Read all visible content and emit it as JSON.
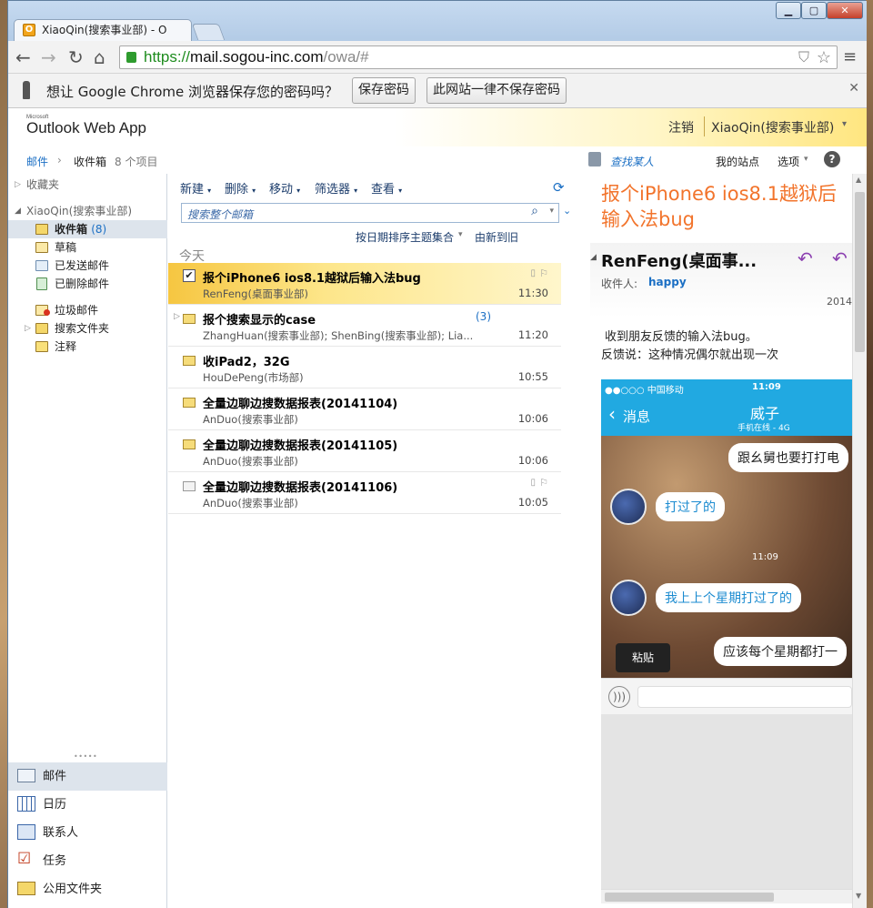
{
  "browser": {
    "tab_title": "XiaoQin(搜索事业部) - O",
    "url_https": "https://",
    "url_host": "mail.sogou-inc.com",
    "url_path": "/owa/#",
    "window_controls": [
      "minimize-icon",
      "maximize-icon",
      "close-icon"
    ]
  },
  "infobar": {
    "message": "想让 Google Chrome 浏览器保存您的密码吗？",
    "save_label": "保存密码",
    "never_label": "此网站一律不保存密码"
  },
  "owa": {
    "logo_small": "Microsoft",
    "logo": "Outlook Web App",
    "signout": "注销",
    "user": "XiaoQin(搜索事业部)",
    "find_people": "查找某人",
    "my_site": "我的站点",
    "options": "选项",
    "help": "?"
  },
  "breadcrumb": {
    "root": "邮件",
    "current": "收件箱",
    "count": "8 个项目"
  },
  "folders": {
    "favorites": "收藏夹",
    "account": "XiaoQin(搜索事业部)",
    "items": [
      {
        "label": "收件箱",
        "count": "(8)"
      },
      {
        "label": "草稿"
      },
      {
        "label": "已发送邮件"
      },
      {
        "label": "已删除邮件"
      },
      {
        "label": "垃圾邮件"
      },
      {
        "label": "搜索文件夹"
      },
      {
        "label": "注释"
      }
    ],
    "handle": "• • • • •"
  },
  "nav": [
    {
      "label": "邮件",
      "icon": "mail-icon"
    },
    {
      "label": "日历",
      "icon": "calendar-icon"
    },
    {
      "label": "联系人",
      "icon": "contacts-icon"
    },
    {
      "label": "任务",
      "icon": "tasks-icon"
    },
    {
      "label": "公用文件夹",
      "icon": "public-folder-icon"
    }
  ],
  "toolbar": {
    "new": "新建",
    "delete": "删除",
    "move": "移动",
    "filter": "筛选器",
    "view": "查看"
  },
  "search": {
    "placeholder": "搜索整个邮箱"
  },
  "sort": {
    "by": "按日期排序主题集合",
    "order": "由新到旧"
  },
  "group_label": "今天",
  "messages": [
    {
      "subject": "报个iPhone6 ios8.1越狱后输入法bug",
      "from": "RenFeng(桌面事业部)",
      "time": "11:30",
      "selected": true,
      "thread": ""
    },
    {
      "subject": "报个搜索显示的case",
      "from": "ZhangHuan(搜索事业部); ShenBing(搜索事业部); Lia...",
      "time": "11:20",
      "thread": "(3)"
    },
    {
      "subject": "收iPad2，32G",
      "from": "HouDePeng(市场部)",
      "time": "10:55",
      "thread": ""
    },
    {
      "subject": "全量边聊边搜数据报表(20141104)",
      "from": "AnDuo(搜索事业部)",
      "time": "10:06",
      "thread": ""
    },
    {
      "subject": "全量边聊边搜数据报表(20141105)",
      "from": "AnDuo(搜索事业部)",
      "time": "10:06",
      "thread": ""
    },
    {
      "subject": "全量边聊边搜数据报表(20141106)",
      "from": "AnDuo(搜索事业部)",
      "time": "10:05",
      "thread": ""
    }
  ],
  "reading": {
    "subject": "报个iPhone6 ios8.1越狱后输入法bug",
    "sender": "RenFeng(桌面事...",
    "to_label": "收件人:",
    "to": "happy",
    "date": "2014",
    "body_line1": "收到朋友反馈的输入法bug。",
    "body_line2": "反馈说：这种情况偶尔就出现一次"
  },
  "phone": {
    "carrier": "●●○○○ 中国移动",
    "time": "11:09",
    "back": "消息",
    "contact": "威子",
    "status": "手机在线 - 4G",
    "msgs": [
      "跟幺舅也要打打电",
      "打过了的",
      "11:09",
      "我上上个星期打过了的",
      "应该每个星期都打一"
    ],
    "paste": "粘贴"
  },
  "colors": {
    "accent": "#1b6fc4",
    "selected_row": "#fde68a",
    "subject_orange": "#f2742c",
    "phone_bar": "#21a9e1"
  }
}
